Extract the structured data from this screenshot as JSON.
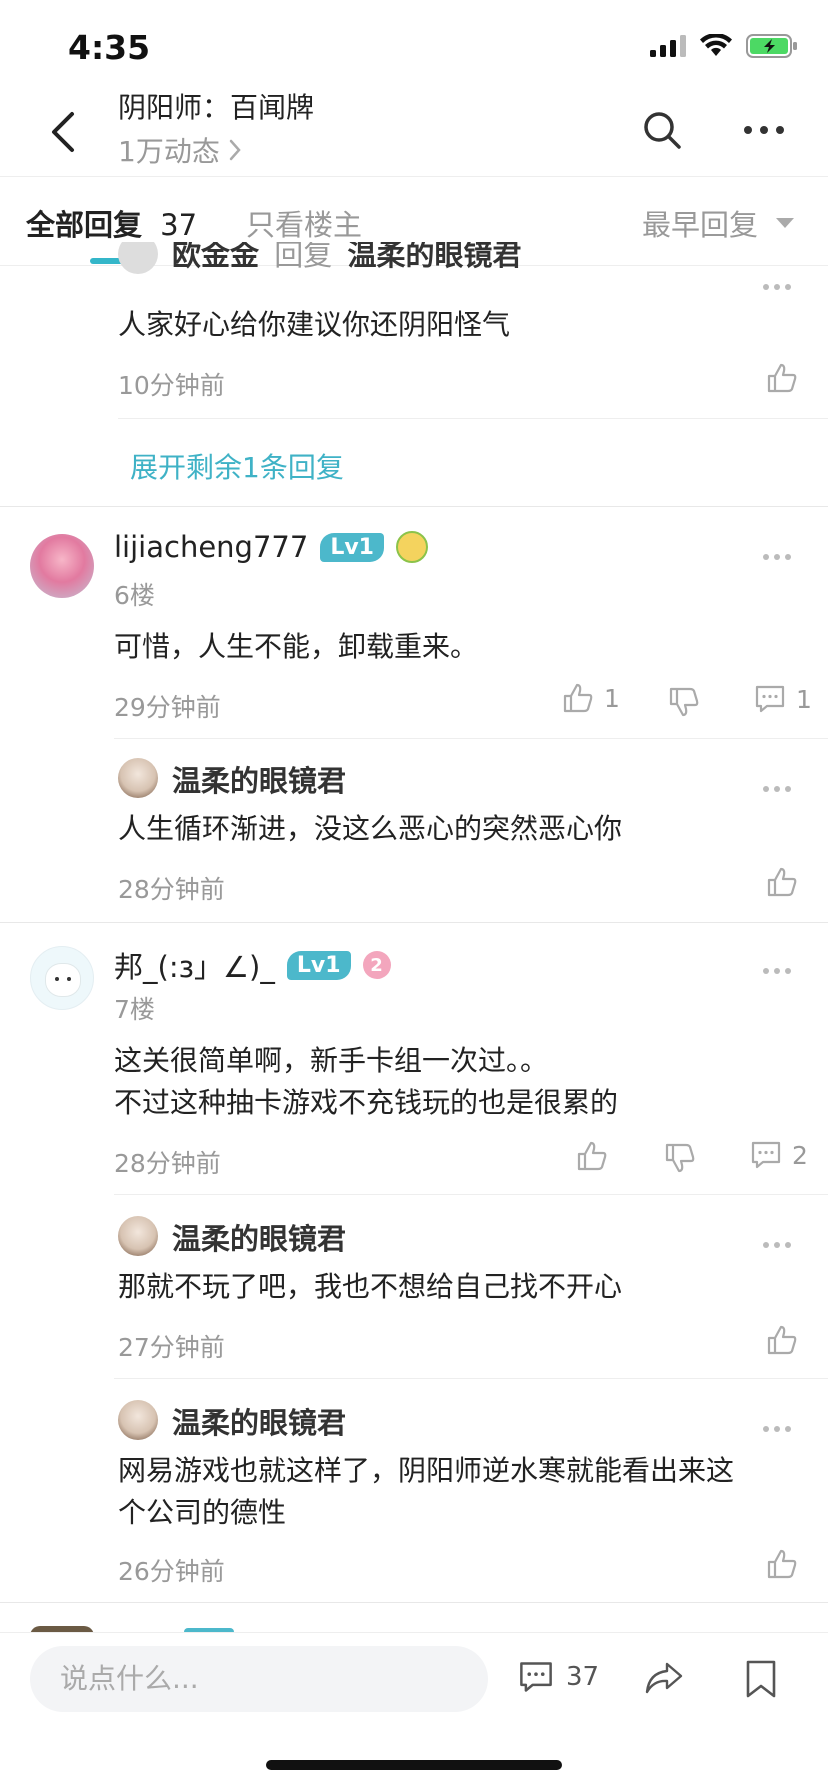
{
  "status_bar": {
    "time": "4:35"
  },
  "header": {
    "title": "阴阳师：百闻牌",
    "subtitle": "1万动态"
  },
  "tabs": {
    "all_label": "全部回复",
    "all_count": "37",
    "op_only": "只看楼主",
    "sort": "最早回复"
  },
  "thread_top": {
    "partial_reply": {
      "author": "欧金金",
      "reply_word": "回复",
      "reply_to": "温柔的眼镜君",
      "text": "人家好心给你建议你还阴阳怪气",
      "time": "10分钟前"
    },
    "expand_label": "展开剩余1条回复"
  },
  "comments": [
    {
      "author": "lijiacheng777",
      "level": "Lv1",
      "floor": "6楼",
      "text": "可惜，人生不能，卸载重来。",
      "time": "29分钟前",
      "likes": "1",
      "replies_count": "1",
      "replies": [
        {
          "author": "温柔的眼镜君",
          "text": "人生循环渐进，没这么恶心的突然恶心你",
          "time": "28分钟前"
        }
      ]
    },
    {
      "author": "邦_(:з」∠)_",
      "level": "Lv1",
      "badge": "2",
      "floor": "7楼",
      "text_line1": "这关很简单啊，新手卡组一次过。。",
      "text_line2": "不过这种抽卡游戏不充钱玩的也是很累的",
      "time": "28分钟前",
      "replies_count": "2",
      "replies": [
        {
          "author": "温柔的眼镜君",
          "text": "那就不玩了吧，我也不想给自己找不开心",
          "time": "27分钟前"
        },
        {
          "author": "温柔的眼镜君",
          "text_line1": "网易游戏也就这样了，阴阳师逆水寒就能看出来这",
          "text_line2": "个公司的德性",
          "time": "26分钟前"
        }
      ]
    }
  ],
  "bottom": {
    "input_placeholder": "说点什么...",
    "comment_count": "37"
  }
}
